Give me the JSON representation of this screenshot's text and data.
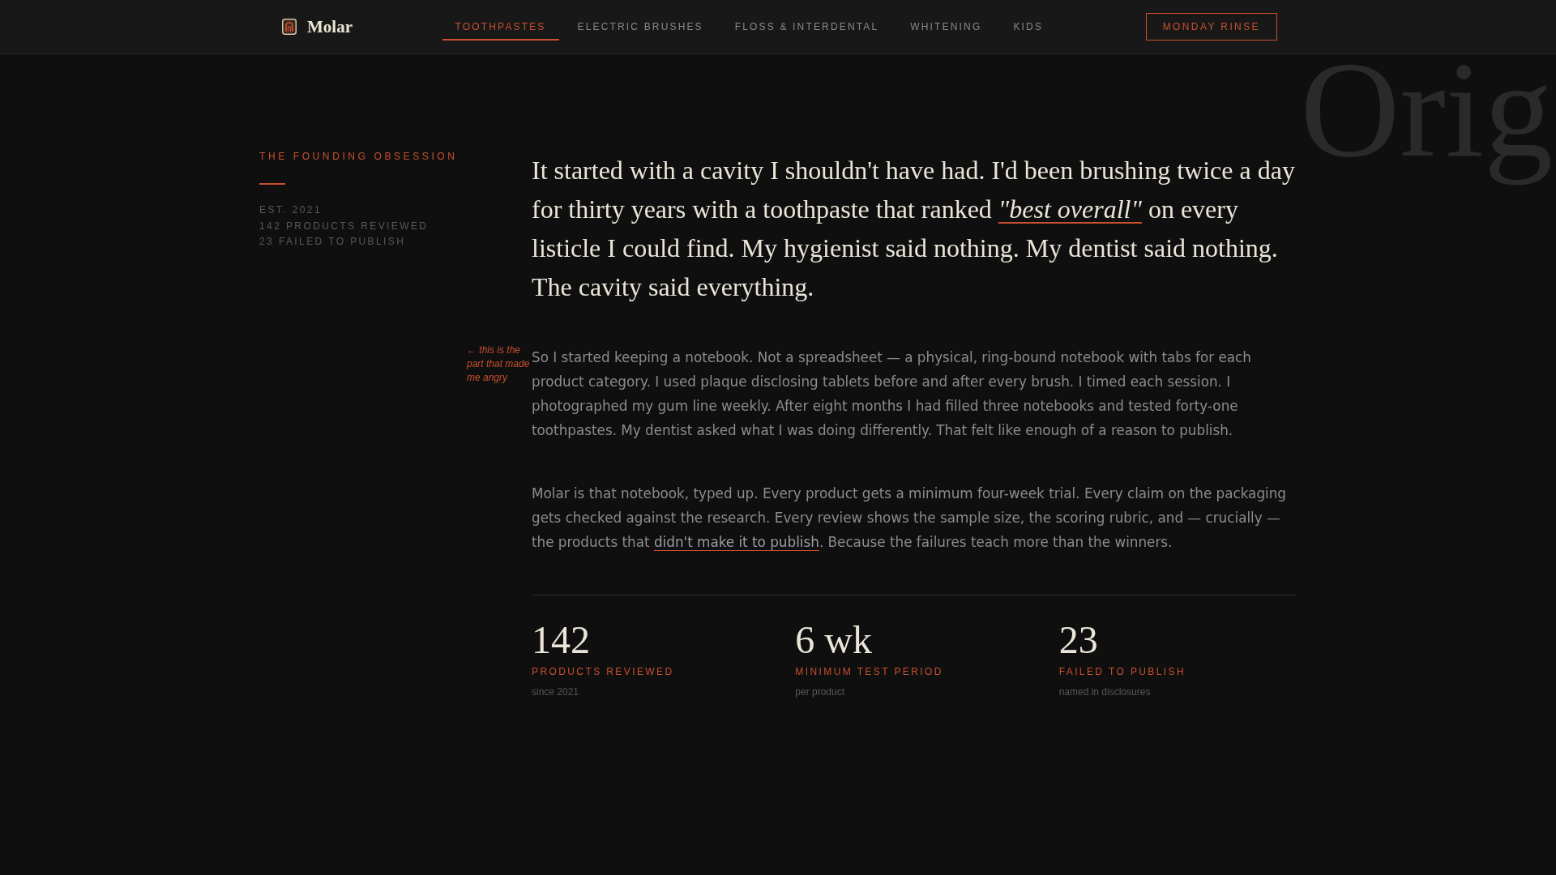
{
  "header": {
    "logo": "Molar",
    "nav": [
      {
        "label": "TOOTHPASTES",
        "selected": true
      },
      {
        "label": "ELECTRIC BRUSHES",
        "selected": false
      },
      {
        "label": "FLOSS & INTERDENTAL",
        "selected": false
      },
      {
        "label": "WHITENING",
        "selected": false
      },
      {
        "label": "KIDS",
        "selected": false
      }
    ],
    "cta": "MONDAY RINSE"
  },
  "background_word": "Orig",
  "sidebar": {
    "eyebrow": "THE FOUNDING OBSESSION",
    "meta": [
      "EST. 2021",
      "142 PRODUCTS REVIEWED",
      "23 FAILED TO PUBLISH"
    ]
  },
  "story": {
    "lead": [
      {
        "kind": "text",
        "text": "It started with a cavity I shouldn't have had. I'd been brushing twice a day for thirty years with a toothpaste that ranked "
      },
      {
        "kind": "link",
        "text": "\"best overall\""
      },
      {
        "kind": "text",
        "text": " on every listicle I could find. My hygienist said nothing. My dentist said nothing. The cavity said everything."
      }
    ],
    "paragraphs": [
      {
        "margin_note": "← this is the part that made me angry",
        "segments": [
          {
            "kind": "text",
            "text": "So I started keeping a notebook. Not a spreadsheet — a physical, ring-bound notebook with tabs for each product category. I used plaque disclosing tablets before and after every brush. I timed each session. I photographed my gum line weekly. After eight months I had filled three notebooks and tested forty-one toothpastes. My dentist asked what I was doing differently. That felt like enough of a reason to publish."
          }
        ]
      },
      {
        "segments": [
          {
            "kind": "text",
            "text": "Molar is that notebook, typed up. Every product gets a minimum four-week trial. Every claim on the packaging gets checked against the research. Every review shows the sample size, the scoring rubric, and — crucially — the products that "
          },
          {
            "kind": "link",
            "text": "didn't make it to publish"
          },
          {
            "kind": "text",
            "text": ". Because the failures teach more than the winners."
          }
        ]
      }
    ]
  },
  "stats": [
    {
      "value": "142",
      "label": "PRODUCTS REVIEWED",
      "note": "since 2021"
    },
    {
      "value": "6 wk",
      "label": "MINIMUM TEST PERIOD",
      "note": "per product"
    },
    {
      "value": "23",
      "label": "FAILED TO PUBLISH",
      "note": "named in disclosures"
    }
  ]
}
